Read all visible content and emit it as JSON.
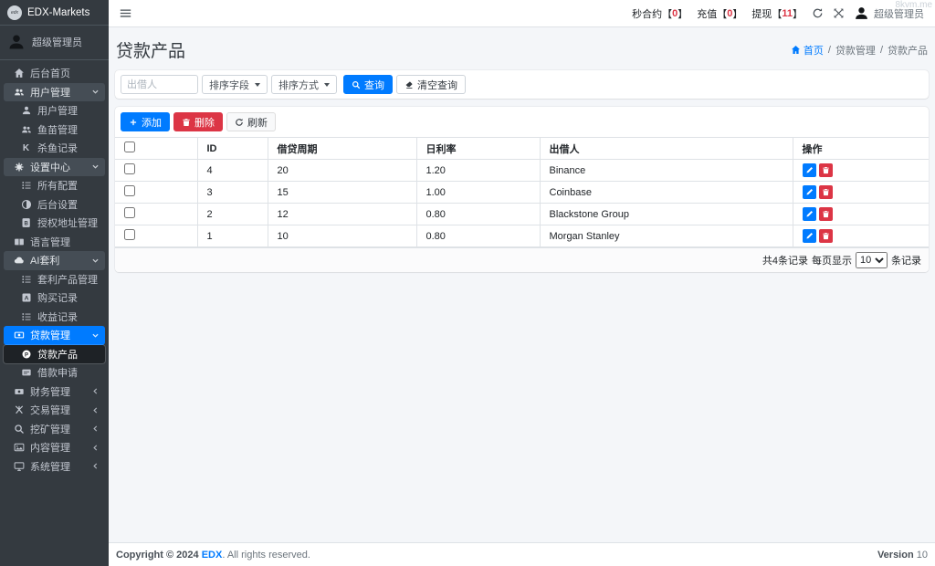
{
  "brand": {
    "name": "EDX-Markets",
    "logo_text": "edx"
  },
  "user": {
    "name": "超级管理员"
  },
  "watermark": "8kvm.me",
  "navbar": {
    "lbracket": "【",
    "rbracket": "】",
    "stats": [
      {
        "label": "秒合约",
        "value": "0"
      },
      {
        "label": "充值",
        "value": "0"
      },
      {
        "label": "提现",
        "value": "11"
      }
    ]
  },
  "sidebar": {
    "items": [
      {
        "label": "后台首页"
      },
      {
        "label": "用户管理"
      },
      {
        "label": "用户管理"
      },
      {
        "label": "鱼苗管理"
      },
      {
        "label": "杀鱼记录"
      },
      {
        "label": "设置中心"
      },
      {
        "label": "所有配置"
      },
      {
        "label": "后台设置"
      },
      {
        "label": "授权地址管理"
      },
      {
        "label": "语言管理"
      },
      {
        "label": "AI套利"
      },
      {
        "label": "套利产品管理"
      },
      {
        "label": "购买记录"
      },
      {
        "label": "收益记录"
      },
      {
        "label": "贷款管理"
      },
      {
        "label": "贷款产品"
      },
      {
        "label": "借款申请"
      },
      {
        "label": "财务管理"
      },
      {
        "label": "交易管理"
      },
      {
        "label": "挖矿管理"
      },
      {
        "label": "内容管理"
      },
      {
        "label": "系统管理"
      }
    ]
  },
  "page": {
    "title": "贷款产品",
    "breadcrumb": {
      "home": "首页",
      "separator": "/",
      "level1": "贷款管理",
      "level2": "贷款产品"
    }
  },
  "search": {
    "placeholder": "出借人",
    "sort_field_label": "排序字段",
    "sort_order_label": "排序方式",
    "query_label": "查询",
    "clear_label": "清空查询"
  },
  "toolbar": {
    "add_label": "添加",
    "delete_label": "删除",
    "refresh_label": "刷新"
  },
  "table": {
    "columns": {
      "id": "ID",
      "period": "借贷周期",
      "rate": "日利率",
      "lender": "出借人",
      "actions": "操作"
    },
    "rows": [
      {
        "id": "4",
        "period": "20",
        "rate": "1.20",
        "lender": "Binance"
      },
      {
        "id": "3",
        "period": "15",
        "rate": "1.00",
        "lender": "Coinbase"
      },
      {
        "id": "2",
        "period": "12",
        "rate": "0.80",
        "lender": "Blackstone Group"
      },
      {
        "id": "1",
        "period": "10",
        "rate": "0.80",
        "lender": "Morgan Stanley"
      }
    ],
    "footer": {
      "total_text": "共4条记录",
      "per_page_label": "每页显示",
      "per_page_value": "10",
      "per_page_suffix": "条记录"
    }
  },
  "footer": {
    "copyright_prefix": "Copyright © 2024",
    "brand": "EDX",
    "copyright_suffix": ". All rights reserved.",
    "version_label": "Version",
    "version_value": "10"
  },
  "colors": {
    "accent": "#007bff",
    "danger": "#dc3545",
    "sidebar_bg": "#343a40"
  }
}
